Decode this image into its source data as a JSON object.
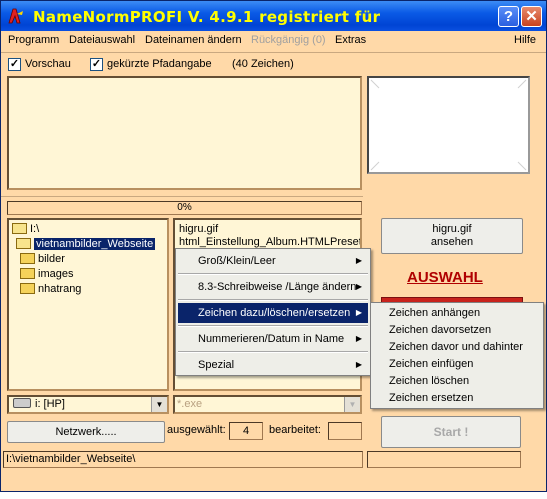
{
  "app": {
    "title": "NameNormPROFI   V. 4.9.1 registriert für",
    "help_button": "?",
    "close_button": "✕"
  },
  "menu": {
    "items": [
      {
        "label": "Programm"
      },
      {
        "label": "Dateiauswahl"
      },
      {
        "label": "Dateinamen ändern"
      },
      {
        "label": "Rückgängig (0)",
        "disabled": true
      },
      {
        "label": "Extras"
      },
      {
        "label": "Hilfe"
      }
    ]
  },
  "options": {
    "preview_label": "Vorschau",
    "preview_checked": true,
    "short_path_label": "gekürzte Pfadangabe",
    "short_path_checked": true,
    "char_count": "(40 Zeichen)"
  },
  "progress": {
    "text": "0%",
    "value": 0
  },
  "tree": {
    "items": [
      {
        "label": "I:\\",
        "icon": "open-folder-icon"
      },
      {
        "label": "vietnambilder_Webseite",
        "icon": "open-folder-icon",
        "selected": true
      },
      {
        "label": "bilder",
        "icon": "folder-icon"
      },
      {
        "label": "images",
        "icon": "folder-icon"
      },
      {
        "label": "nhatrang",
        "icon": "folder-icon"
      }
    ]
  },
  "files": {
    "items": [
      "higru.gif",
      "html_Einstellung_Album.HTMLPreset"
    ]
  },
  "view_button": {
    "line1": "higru.gif",
    "line2": "ansehen"
  },
  "auswahl_label": "AUSWAHL",
  "drive": {
    "value": "i: [HP]"
  },
  "filter": {
    "value": "*.exe"
  },
  "network_button": "Netzwerk.....",
  "stats": {
    "selected_label": "ausgewählt:",
    "selected_value": "4",
    "edited_label": "bearbeitet:",
    "edited_value": ""
  },
  "start_button": "Start !",
  "status_path": "I:\\vietnambilder_Webseite\\",
  "context_menu": {
    "items": [
      {
        "label": "Groß/Klein/Leer",
        "submenu": true
      },
      {
        "label": "8.3-Schreibweise /Länge ändern",
        "submenu": true
      },
      {
        "label": "Zeichen  dazu/löschen/ersetzen",
        "submenu": true,
        "highlighted": true
      },
      {
        "label": "Nummerieren/Datum in Name",
        "submenu": true
      },
      {
        "label": "Spezial",
        "submenu": true
      }
    ]
  },
  "submenu": {
    "items": [
      "Zeichen anhängen",
      "Zeichen davorsetzen",
      "Zeichen davor und dahinter",
      "Zeichen einfügen",
      "Zeichen löschen",
      "Zeichen ersetzen"
    ]
  },
  "colors": {
    "window_bg": "#ffd9a8",
    "title_text": "#ffff00",
    "highlight": "#0a246a",
    "auswahl_text": "#b00000"
  }
}
